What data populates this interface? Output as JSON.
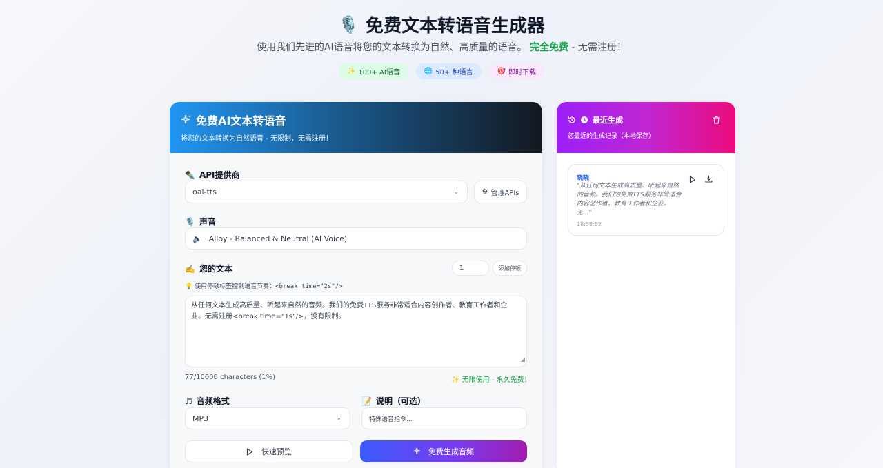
{
  "hero": {
    "title": "免费文本转语音生成器",
    "subtitle_prefix": "使用我们先进的AI语音将您的文本转换为自然、高质量的语音。",
    "subtitle_free": "完全免费",
    "subtitle_suffix": " - 无需注册！",
    "badges": [
      {
        "icon": "sparkle",
        "label": "100+ AI语音"
      },
      {
        "icon": "globe",
        "label": "50+ 种语言"
      },
      {
        "icon": "target",
        "label": "即时下载"
      }
    ]
  },
  "main": {
    "title": "免费AI文本转语音",
    "subtitle": "将您的文本转换为自然语音 - 无限制，无需注册！",
    "api_label": "API提供商",
    "api_value": "oai-tts",
    "manage_apis": "管理APIs",
    "voice_label": "声音",
    "voice_value": "Alloy - Balanced & Neutral (AI Voice)",
    "text_label": "您的文本",
    "pause_value": "1",
    "add_pause": "添加停顿",
    "hint_prefix": "使用停顿标签控制语音节奏：",
    "hint_code": "<break time=\"2s\"/>",
    "text_content": "从任何文本生成高质量、听起来自然的音频。我们的免费TTS服务非常适合内容创作者、教育工作者和企业。无需注册<break time=\"1s\"/>，没有限制。",
    "char_count": "77/10000 characters (1%)",
    "unlimited": "无限使用 - 永久免费！",
    "format_label": "音频格式",
    "format_value": "MP3",
    "desc_label": "说明（可选）",
    "desc_placeholder": "特殊语音指令...",
    "preview_button": "快速预览",
    "generate_button": "免费生成音频"
  },
  "sidebar": {
    "title": "最近生成",
    "subtitle": "您最近的生成记录（本地保存）",
    "history": [
      {
        "voice": "晓晓",
        "text": "\"从任何文本生成高质量、听起来自然的音频。我们的免费TTS服务非常适合内容创作者、教育工作者和企业。无...\"",
        "time": "18:58:52"
      }
    ]
  },
  "colors": {
    "accent_blue": "#2196f3",
    "accent_purple": "#9b1ff6",
    "accent_pink": "#ec0b7d",
    "free_green": "#16a34a"
  }
}
